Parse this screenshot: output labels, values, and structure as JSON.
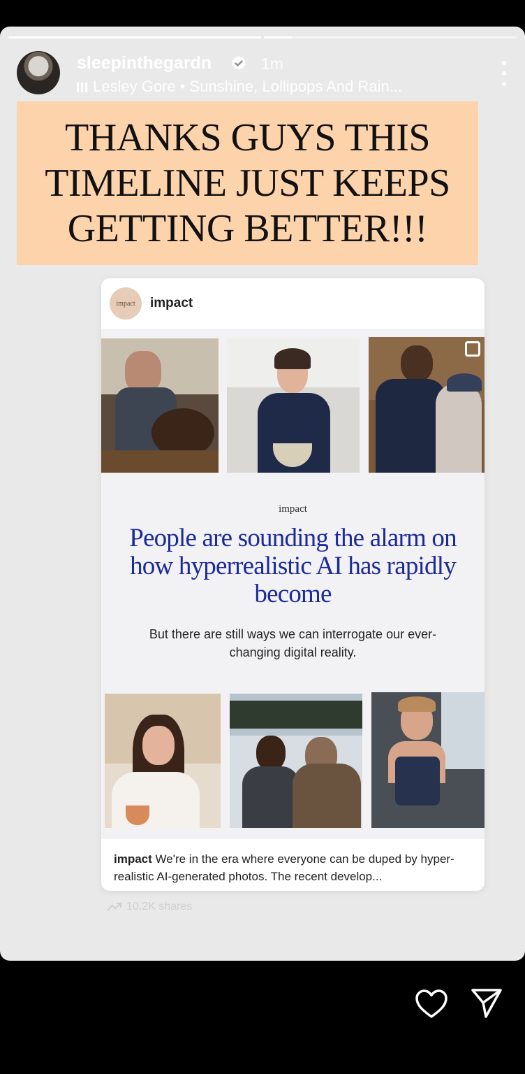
{
  "story": {
    "progress_segments": [
      {
        "label": "segment-1",
        "progress": 1.0
      },
      {
        "label": "segment-2",
        "progress": 0.11
      }
    ],
    "username": "sleepinthegardn",
    "verified": true,
    "time_ago": "1m",
    "music": "Lesley Gore • Sunshine, Lollipops And Rain...",
    "banner_text": "THANKS GUYS THIS TIMELINE JUST KEEPS GETTING BETTER!!!",
    "banner_color": "#fdd3ab",
    "background_color": "#e9e9e9"
  },
  "shared_post": {
    "account_avatar_text": "impact",
    "account_name": "impact",
    "brand": "impact",
    "headline": "People are sounding the alarm on how hyperrealistic AI has rapidly become",
    "subheadline": "But there are still ways we can interrogate our ever-changing digital reality.",
    "headline_color": "#1c2a9a",
    "caption_user": "impact",
    "caption_text": "We're in the era where everyone can be duped by hyper-realistic AI-generated photos. The recent develop...",
    "shares": "10.2K shares"
  },
  "actions": {
    "like_icon": "heart-icon",
    "send_icon": "send-icon"
  }
}
